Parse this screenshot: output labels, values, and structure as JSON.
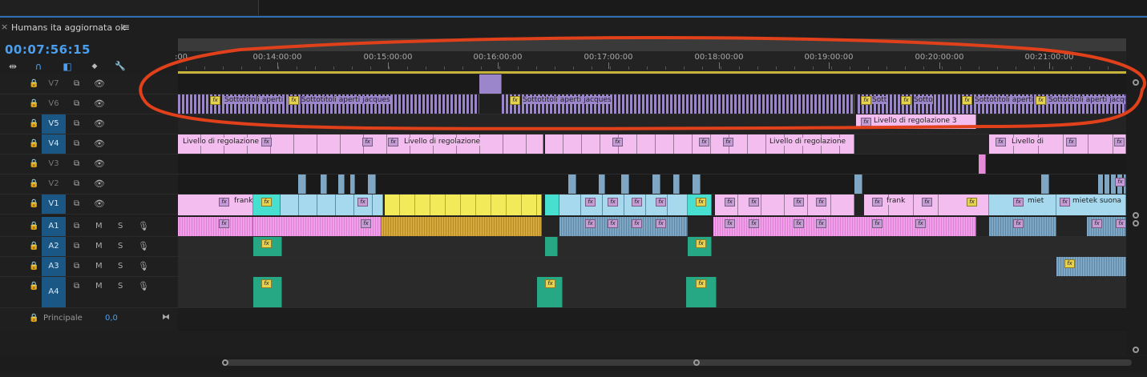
{
  "sequence": {
    "title": "Humans ita aggiornata ok",
    "close_glyph": "×",
    "menu_glyph": "≡",
    "timecode": "00:07:56:15"
  },
  "toolbar": [
    {
      "name": "insert-overwrite-icon",
      "glyph": "⇹"
    },
    {
      "name": "snap-magnet-icon",
      "glyph": "∩"
    },
    {
      "name": "linked-selection-icon",
      "glyph": "◧"
    },
    {
      "name": "add-marker-icon",
      "glyph": "◆"
    },
    {
      "name": "wrench-settings-icon",
      "glyph": "🔧"
    }
  ],
  "ruler": {
    "start_label": ":00",
    "labels": [
      "00:14:00:00",
      "00:15:00:00",
      "00:16:00:00",
      "00:17:00:00",
      "00:18:00:00",
      "00:19:00:00",
      "00:20:00:00",
      "00:21:00:00"
    ]
  },
  "tracks": [
    {
      "id": "v7",
      "label": "V7",
      "type": "video",
      "selected": false
    },
    {
      "id": "v6",
      "label": "V6",
      "type": "video",
      "selected": false
    },
    {
      "id": "v5",
      "label": "V5",
      "type": "video",
      "selected": true
    },
    {
      "id": "v4",
      "label": "V4",
      "type": "video",
      "selected": true
    },
    {
      "id": "v3",
      "label": "V3",
      "type": "video",
      "selected": false
    },
    {
      "id": "v2",
      "label": "V2",
      "type": "video",
      "selected": false
    },
    {
      "id": "v1",
      "label": "V1",
      "type": "video",
      "selected": true
    },
    {
      "id": "a1",
      "label": "A1",
      "type": "audio",
      "selected": true,
      "m": "M",
      "s": "S"
    },
    {
      "id": "a2",
      "label": "A2",
      "type": "audio",
      "selected": true,
      "m": "M",
      "s": "S"
    },
    {
      "id": "a3",
      "label": "A3",
      "type": "audio",
      "selected": true,
      "m": "M",
      "s": "S"
    },
    {
      "id": "a4",
      "label": "A4",
      "type": "audio",
      "selected": true,
      "m": "M",
      "s": "S"
    }
  ],
  "master": {
    "label": "Principale",
    "value": "0,0"
  },
  "clip_labels": {
    "v6_a": "Sottotitoli aperti",
    "v6_b": "Sottotitoli aperti jacques",
    "v6_c": "Sottotitoli aperti jacques",
    "v6_d": "Sott",
    "v6_e": "Sotto",
    "v6_f": "Sottotitoli aperti",
    "v6_g": "Sottotitoli aperti jacques",
    "v5_adj": "Livello di regolazione 3",
    "v4_a": "Livello di regolazione",
    "v4_b": "Livello di regolazione",
    "v4_c": "Livello di regolazione",
    "v4_d": "Livello di",
    "v1_frank1": "frank",
    "v1_frank2": "frank",
    "v1_miet": "miet",
    "v1_mietek": "mietek suona"
  },
  "fx_glyph": "fx",
  "colors": {
    "accent_blue": "#4b9ff0",
    "caption_purple": "#9b86cc",
    "adjustment_pink": "#f3bdf0",
    "clip_blue": "#a6d8ee",
    "clip_cyan": "#47e0d0",
    "clip_yellow": "#f3ea5a",
    "audio_pink": "#f0a0e8",
    "audio_blue": "#7fa7c4",
    "audio_green": "#27a884",
    "annotation_red": "#e0401a"
  }
}
